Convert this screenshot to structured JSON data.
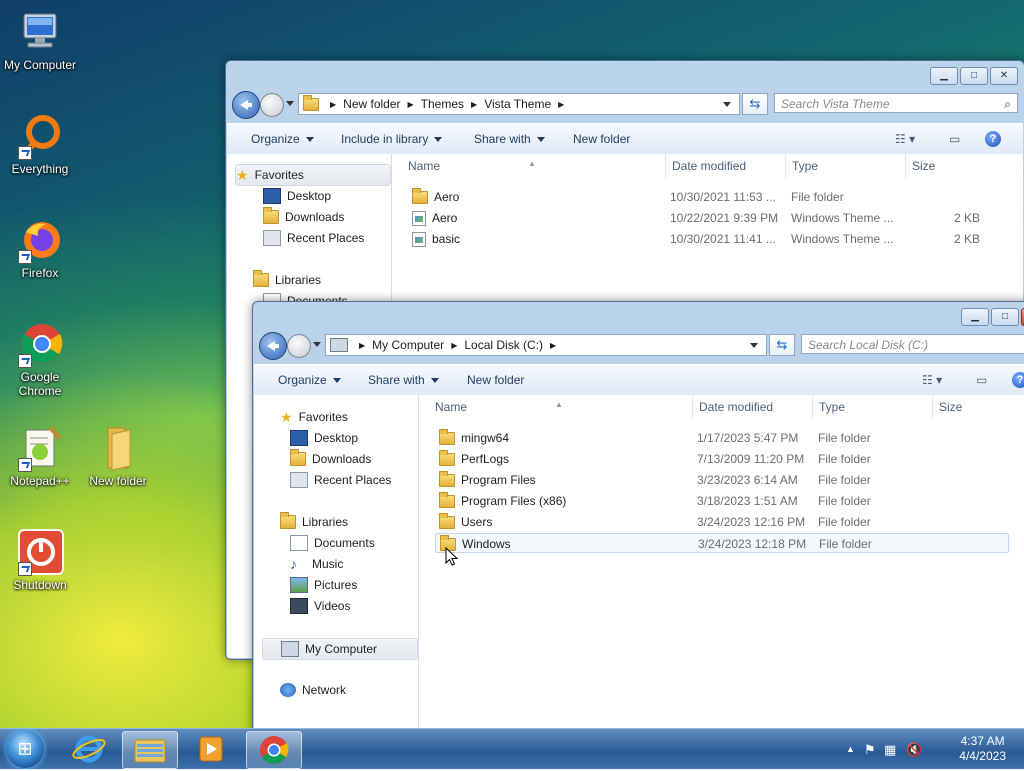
{
  "desktop": {
    "icons": [
      {
        "label": "My Computer"
      },
      {
        "label": "Everything"
      },
      {
        "label": "Firefox"
      },
      {
        "label": "Google Chrome"
      },
      {
        "label": "Notepad++"
      },
      {
        "label": "New folder"
      },
      {
        "label": "Shutdown"
      }
    ]
  },
  "window_back": {
    "breadcrumbs": [
      "New folder",
      "Themes",
      "Vista Theme"
    ],
    "search_placeholder": "Search Vista Theme",
    "toolbar": {
      "organize": "Organize",
      "include_in_library": "Include in library",
      "share_with": "Share with",
      "new_folder": "New folder"
    },
    "nav": {
      "favorites": "Favorites",
      "desktop": "Desktop",
      "downloads": "Downloads",
      "recent_places": "Recent Places",
      "libraries": "Libraries",
      "documents": "Documents"
    },
    "columns": {
      "name": "Name",
      "date_modified": "Date modified",
      "type": "Type",
      "size": "Size"
    },
    "files": [
      {
        "name": "Aero",
        "date": "10/30/2021 11:53 ...",
        "type": "File folder",
        "size": "",
        "icon": "folder"
      },
      {
        "name": "Aero",
        "date": "10/22/2021 9:39 PM",
        "type": "Windows Theme ...",
        "size": "2 KB",
        "icon": "theme"
      },
      {
        "name": "basic",
        "date": "10/30/2021 11:41 ...",
        "type": "Windows Theme ...",
        "size": "2 KB",
        "icon": "theme"
      }
    ]
  },
  "window_front": {
    "breadcrumbs": [
      "My Computer",
      "Local Disk (C:)"
    ],
    "search_placeholder": "Search Local Disk (C:)",
    "toolbar": {
      "organize": "Organize",
      "share_with": "Share with",
      "new_folder": "New folder"
    },
    "nav": {
      "favorites": "Favorites",
      "desktop": "Desktop",
      "downloads": "Downloads",
      "recent_places": "Recent Places",
      "libraries": "Libraries",
      "documents": "Documents",
      "music": "Music",
      "pictures": "Pictures",
      "videos": "Videos",
      "my_computer": "My Computer",
      "network": "Network"
    },
    "columns": {
      "name": "Name",
      "date_modified": "Date modified",
      "type": "Type",
      "size": "Size"
    },
    "files": [
      {
        "name": "mingw64",
        "date": "1/17/2023 5:47 PM",
        "type": "File folder"
      },
      {
        "name": "PerfLogs",
        "date": "7/13/2009 11:20 PM",
        "type": "File folder"
      },
      {
        "name": "Program Files",
        "date": "3/23/2023 6:14 AM",
        "type": "File folder"
      },
      {
        "name": "Program Files (x86)",
        "date": "3/18/2023 1:51 AM",
        "type": "File folder"
      },
      {
        "name": "Users",
        "date": "3/24/2023 12:16 PM",
        "type": "File folder"
      },
      {
        "name": "Windows",
        "date": "3/24/2023 12:18 PM",
        "type": "File folder"
      }
    ]
  },
  "taskbar": {
    "clock_time": "4:37 AM",
    "clock_date": "4/4/2023",
    "buttons": [
      "internet-explorer-icon",
      "explorer-icon",
      "media-player-icon",
      "chrome-icon"
    ]
  }
}
